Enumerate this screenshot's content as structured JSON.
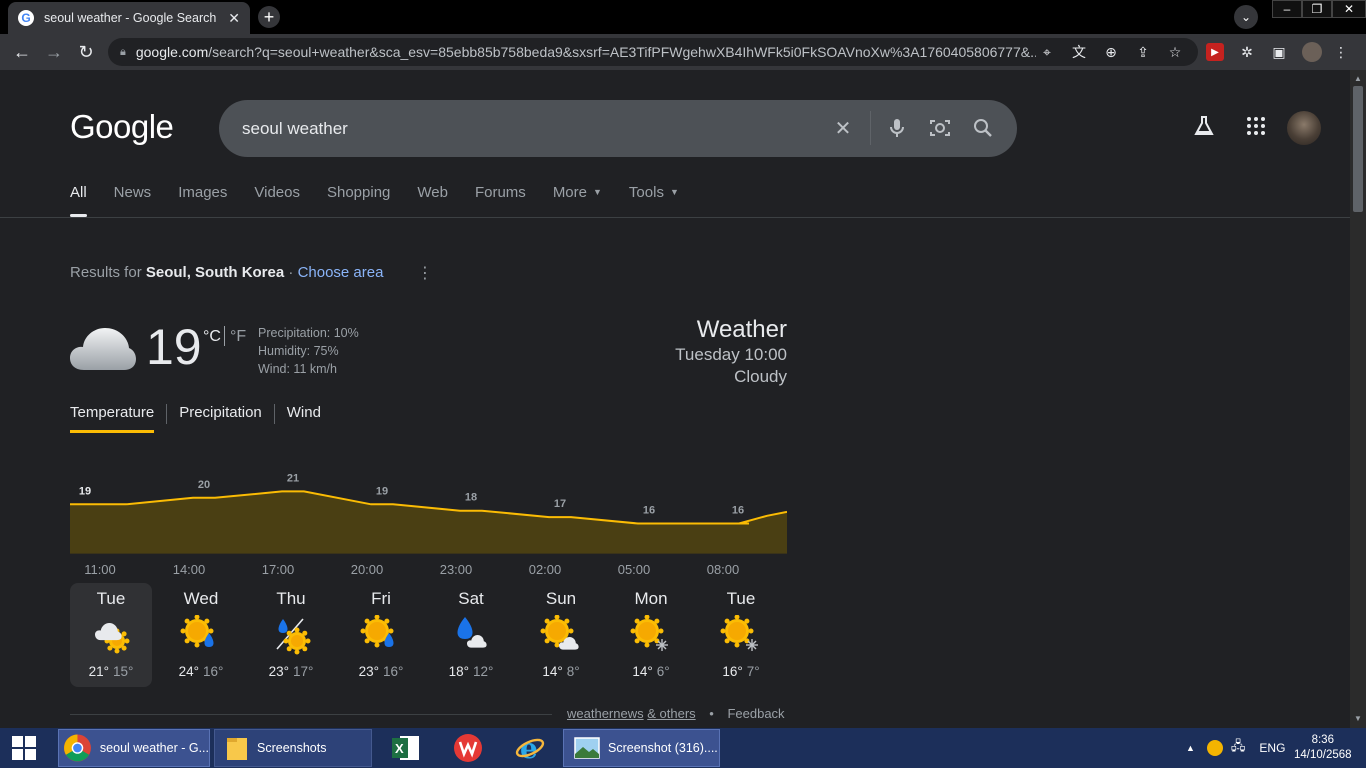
{
  "browser": {
    "tab_title": "seoul weather - Google Search",
    "url_host": "google.com",
    "url_rest": "/search?q=seoul+weather&sca_esv=85ebb85b758beda9&sxsrf=AE3TifPFWgehwXB4IhWFk5i0FkSOAVnoXw%3A1760405806777&..."
  },
  "header": {
    "logo": "Google",
    "query": "seoul weather"
  },
  "tabs": [
    {
      "label": "All",
      "active": true
    },
    {
      "label": "News"
    },
    {
      "label": "Images"
    },
    {
      "label": "Videos"
    },
    {
      "label": "Shopping"
    },
    {
      "label": "Web"
    },
    {
      "label": "Forums"
    },
    {
      "label": "More"
    },
    {
      "label": "Tools"
    }
  ],
  "results_for": {
    "prefix": "Results for ",
    "place": "Seoul, South Korea",
    "separator": " · ",
    "link": "Choose area"
  },
  "weather": {
    "temp": "19",
    "unit_c": "°C",
    "unit_f": "°F",
    "precipitation": "Precipitation: 10%",
    "humidity": "Humidity: 75%",
    "wind": "Wind: 11 km/h",
    "heading": "Weather",
    "datetime": "Tuesday 10:00",
    "condition": "Cloudy",
    "views": [
      "Temperature",
      "Precipitation",
      "Wind"
    ]
  },
  "chart_data": {
    "type": "area",
    "x": [
      "11:00",
      "14:00",
      "17:00",
      "20:00",
      "23:00",
      "02:00",
      "05:00",
      "08:00"
    ],
    "values": [
      19,
      20,
      21,
      19,
      18,
      17,
      16,
      16
    ],
    "title": "",
    "xlabel": "",
    "ylabel": "",
    "colors": {
      "line": "#fbbc04",
      "fill": "#4a3f13"
    }
  },
  "forecast": [
    {
      "day": "Tue",
      "hi": "21°",
      "lo": "15°",
      "icon": "cloud-sun-icon",
      "selected": true
    },
    {
      "day": "Wed",
      "hi": "24°",
      "lo": "16°",
      "icon": "sun-rain-icon"
    },
    {
      "day": "Thu",
      "hi": "23°",
      "lo": "17°",
      "icon": "rain-sun-split-icon"
    },
    {
      "day": "Fri",
      "hi": "23°",
      "lo": "16°",
      "icon": "sun-rain-icon"
    },
    {
      "day": "Sat",
      "hi": "18°",
      "lo": "12°",
      "icon": "rain-cloud-icon"
    },
    {
      "day": "Sun",
      "hi": "14°",
      "lo": "8°",
      "icon": "sun-cloud-icon"
    },
    {
      "day": "Mon",
      "hi": "14°",
      "lo": "6°",
      "icon": "sun-snow-icon"
    },
    {
      "day": "Tue",
      "hi": "16°",
      "lo": "7°",
      "icon": "sun-snow-icon"
    }
  ],
  "source": {
    "provider": "weathernews",
    "amp": "& others",
    "feedback": "Feedback"
  },
  "taskbar": {
    "items": [
      "seoul weather - G...",
      "Screenshots",
      "Screenshot (316)...."
    ],
    "lang": "ENG",
    "time": "8:36",
    "date": "14/10/2568"
  },
  "colors": {
    "accent": "#fbbc04",
    "link": "#8ab4f8",
    "background": "#202124"
  }
}
